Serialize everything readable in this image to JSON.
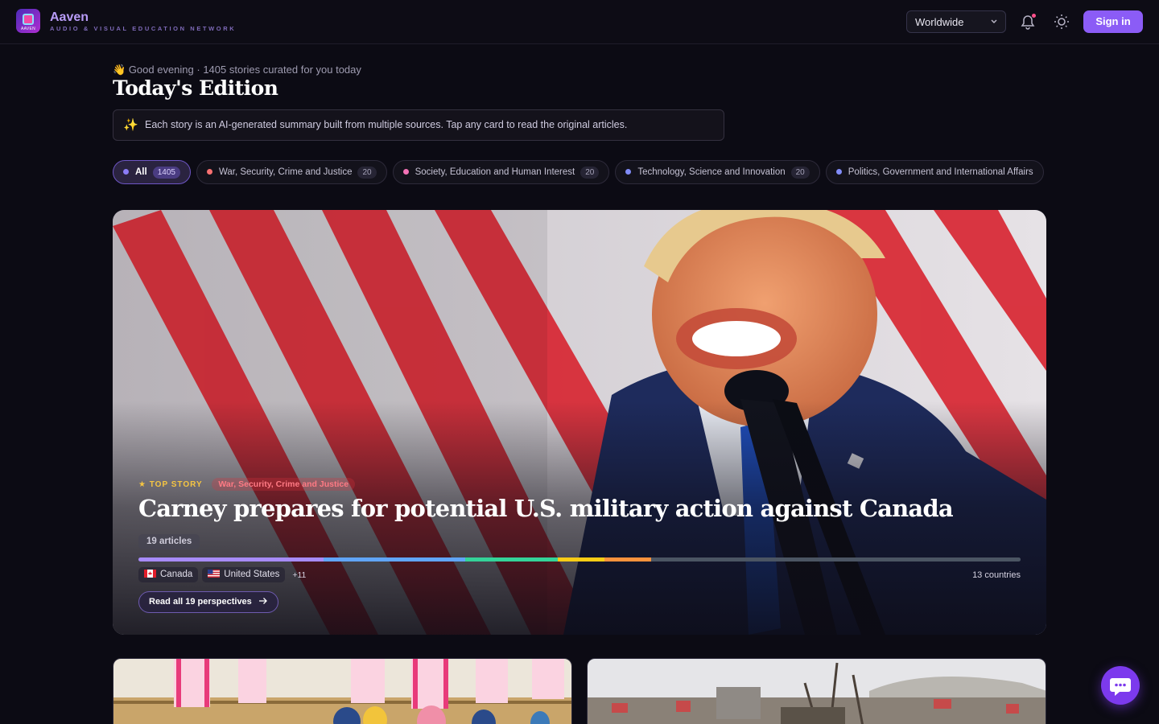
{
  "brand": {
    "name": "Aaven",
    "tagline": "AUDIO & VISUAL EDUCATION NETWORK",
    "logo_text": "AAVEN"
  },
  "header": {
    "region": "Worldwide",
    "signin_label": "Sign in",
    "notification_icon": "bell-icon",
    "theme_icon": "sun-icon"
  },
  "greeting": {
    "emoji": "👋",
    "text": "Good evening · 1405 stories curated for you today"
  },
  "page": {
    "title": "Today's Edition"
  },
  "notice": {
    "icon": "sparkles-icon",
    "text": "Each story is an AI-generated summary built from multiple sources. Tap any card to read the original articles."
  },
  "categories": [
    {
      "label": "All",
      "count": "1405",
      "color": "#8b7cf6",
      "active": true
    },
    {
      "label": "War, Security, Crime and Justice",
      "count": "20",
      "color": "#f87171"
    },
    {
      "label": "Society, Education and Human Interest",
      "count": "20",
      "color": "#f472b6"
    },
    {
      "label": "Technology, Science and Innovation",
      "count": "20",
      "color": "#818cf8"
    },
    {
      "label": "Politics, Government and International Affairs",
      "count": "",
      "color": "#818cf8"
    }
  ],
  "hero": {
    "top_label": "★ TOP STORY",
    "category": "War, Security, Crime and Justice",
    "title": "Carney prepares for potential U.S. military action against Canada",
    "articles": "19 articles",
    "spectrum": [
      {
        "color": "#a78bfa",
        "share": 21
      },
      {
        "color": "#60a5fa",
        "share": 16
      },
      {
        "color": "#34d399",
        "share": 10.5
      },
      {
        "color": "#facc15",
        "share": 5.3
      },
      {
        "color": "#fb923c",
        "share": 5.3
      },
      {
        "color": "#4b5563",
        "share": 41.9
      }
    ],
    "countries": [
      {
        "name": "Canada",
        "flag": "canada-flag"
      },
      {
        "name": "United States",
        "flag": "us-flag"
      }
    ],
    "more_countries": "+11",
    "country_count": "13 countries",
    "read_label": "Read all 19 perspectives",
    "read_icon": "arrow-right-icon"
  },
  "chat": {
    "icon": "chat-bubble-icon"
  }
}
